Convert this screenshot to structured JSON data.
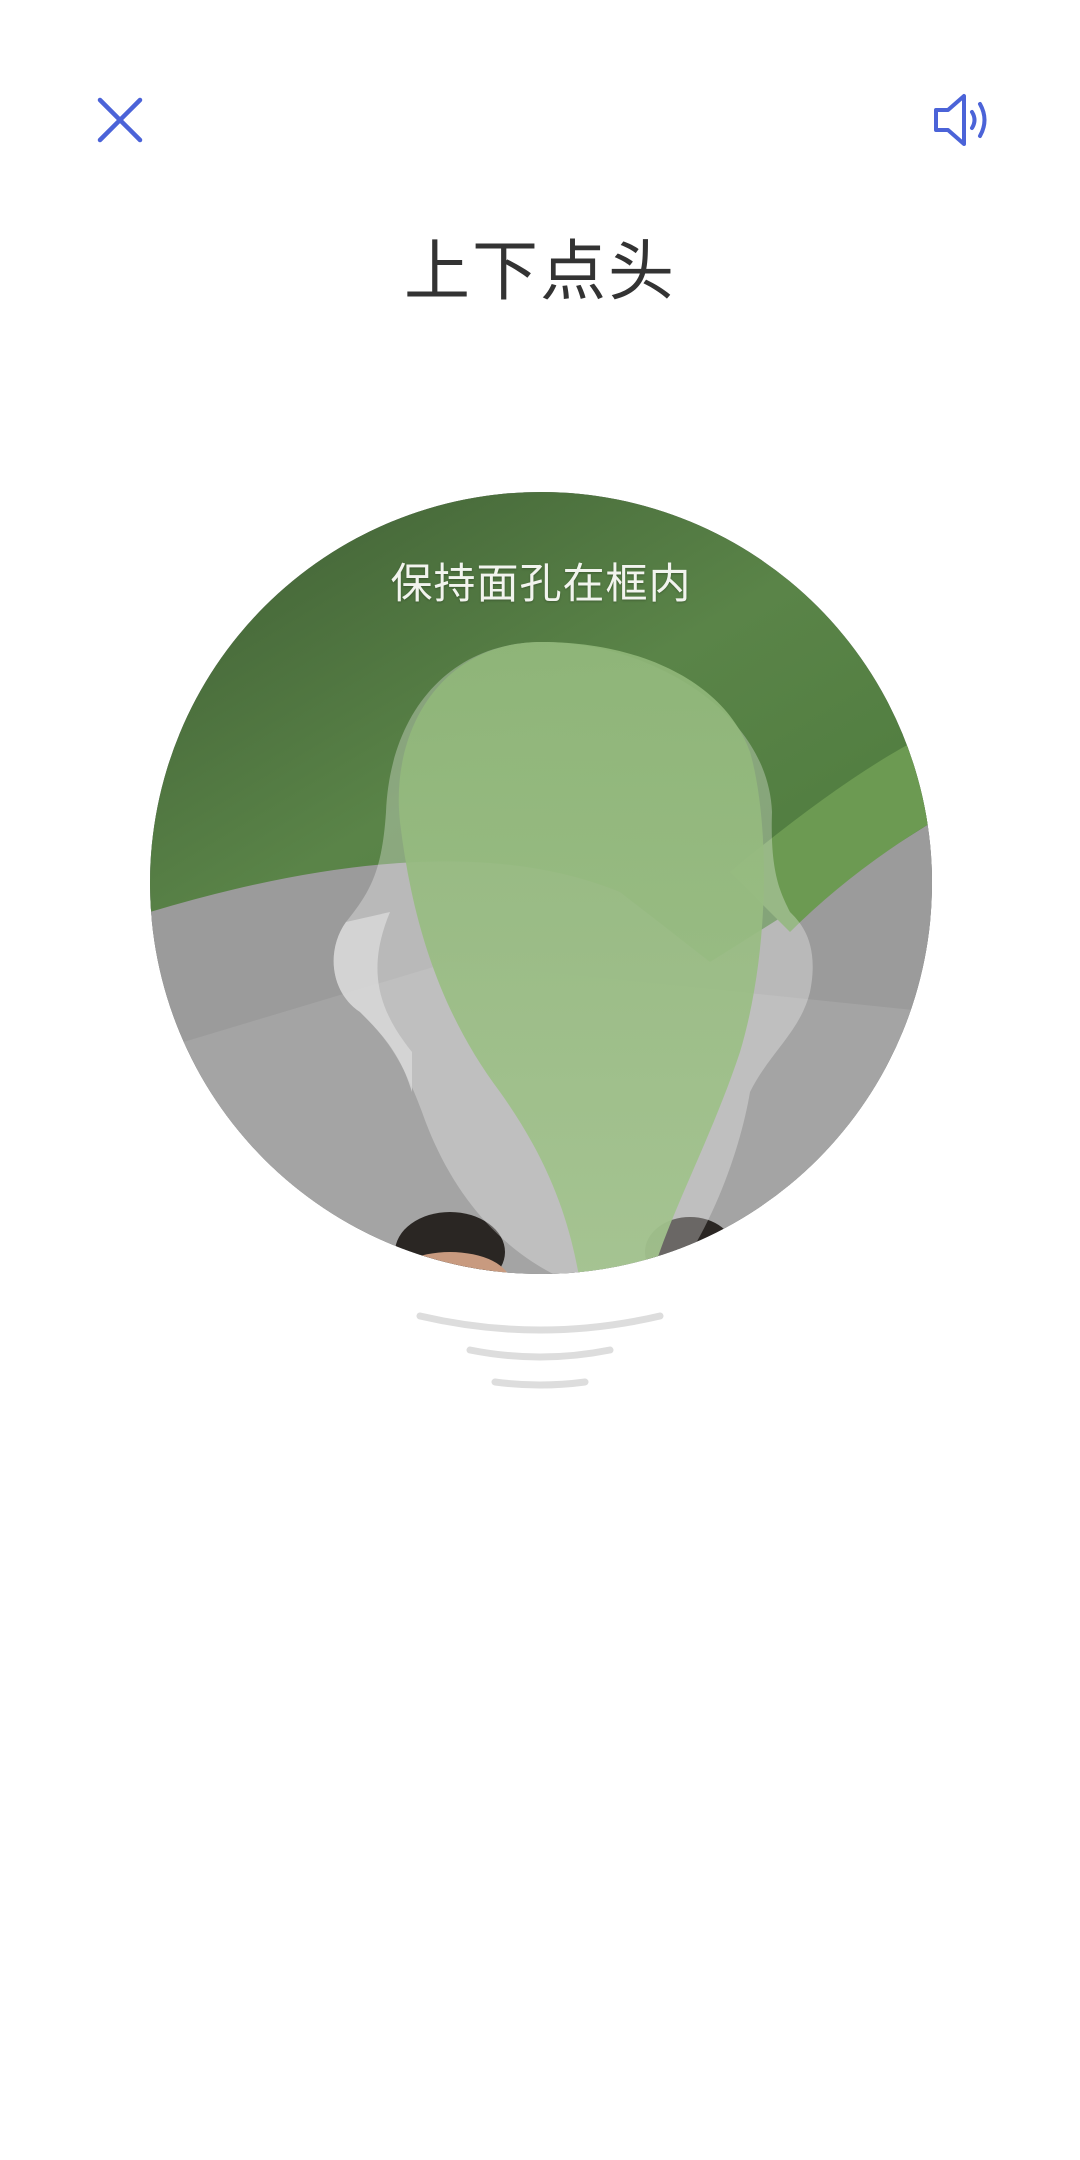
{
  "header": {
    "close_icon": "close-icon",
    "sound_icon": "speaker-icon",
    "accent_color": "#4B63D8"
  },
  "instruction": {
    "title": "上下点头"
  },
  "camera": {
    "hint": "保持面孔在框内"
  },
  "nod_indicator_icon": "nod-arcs-icon"
}
